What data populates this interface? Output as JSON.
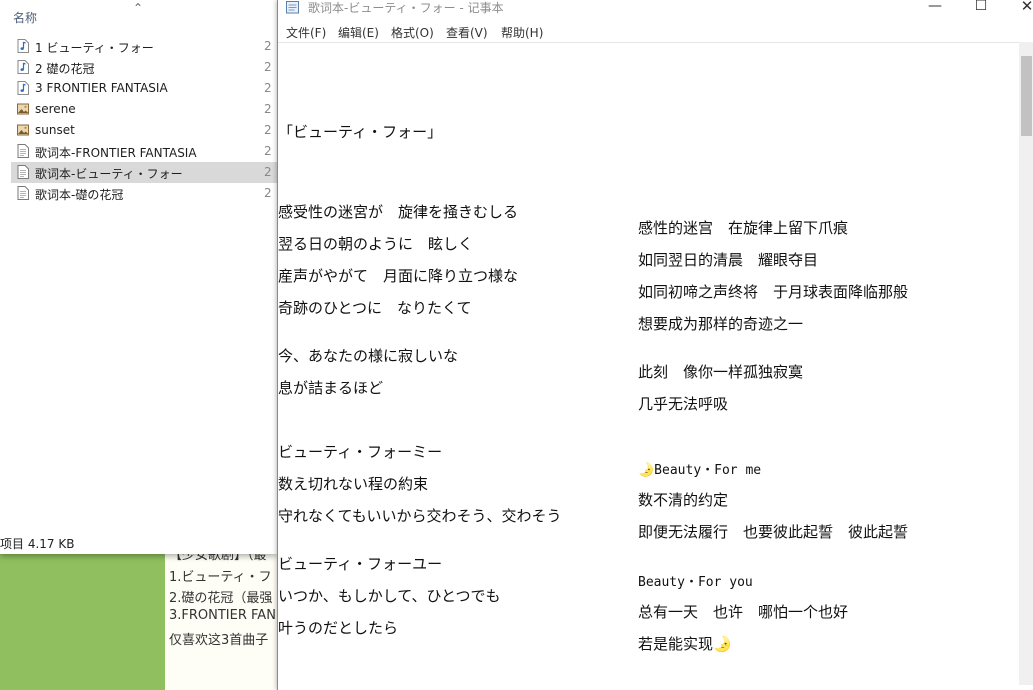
{
  "background_doc": {
    "lines": [
      "【少女歌剧】（最",
      "1.ビューティ・フ",
      "2.礎の花冠（最强",
      "3.FRONTIER FAN",
      "仅喜欢这3首曲子"
    ]
  },
  "explorer": {
    "column_name": "名称",
    "items": [
      {
        "label": "1 ビューティ・フォー",
        "icon": "music-file-icon",
        "trunc": "2"
      },
      {
        "label": "2 礎の花冠",
        "icon": "music-file-icon",
        "trunc": "2"
      },
      {
        "label": "3 FRONTIER FANTASIA",
        "icon": "music-file-icon",
        "trunc": "2"
      },
      {
        "label": "serene",
        "icon": "image-file-icon",
        "trunc": "2"
      },
      {
        "label": "sunset",
        "icon": "image-file-icon",
        "trunc": "2"
      },
      {
        "label": "歌词本-FRONTIER FANTASIA",
        "icon": "text-file-icon",
        "trunc": "2"
      },
      {
        "label": "歌词本-ビューティ・フォー",
        "icon": "text-file-icon",
        "trunc": "2"
      },
      {
        "label": "歌词本-礎の花冠",
        "icon": "text-file-icon",
        "trunc": "2"
      }
    ],
    "status": "项目  4.17 KB"
  },
  "notepad": {
    "title": "歌词本-ビューティ・フォー - 记事本",
    "menu": [
      "文件(F)",
      "编辑(E)",
      "格式(O)",
      "查看(V)",
      "帮助(H)"
    ],
    "song_title": "「ビューティ・フォー」",
    "japanese": [
      "感受性の迷宮が　旋律を掻きむしる",
      "翌る日の朝のように　眩しく",
      "産声がやがて　月面に降り立つ様な",
      "奇跡のひとつに　なりたくて",
      "今、あなたの様に寂しいな",
      "息が詰まるほど",
      "ビューティ・フォーミー",
      "数え切れない程の約束",
      "守れなくてもいいから交わそう、交わそう",
      "ビューティ・フォーユー",
      "いつか、もしかして、ひとつでも",
      "叶うのだとしたら"
    ],
    "chinese": [
      "感性的迷宫　在旋律上留下爪痕",
      "如同翌日的清晨　耀眼夺目",
      "如同初啼之声终将　于月球表面降临那般",
      "想要成为那样的奇迹之一",
      "此刻　像你一样孤独寂寞",
      "几乎无法呼吸",
      "🌛Beauty・For me",
      "数不清的约定",
      "即便无法履行　也要彼此起誓　彼此起誓",
      "Beauty・For you",
      "总有一天　也许　哪怕一个也好",
      "若是能实现🌛"
    ]
  }
}
